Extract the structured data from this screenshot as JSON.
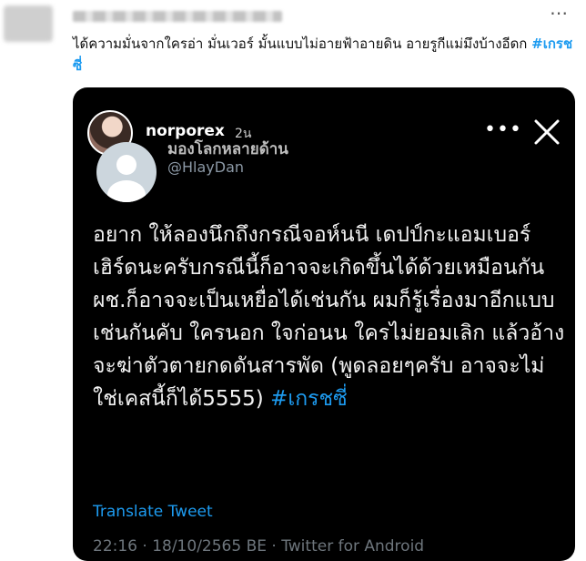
{
  "tweet": {
    "text": "ได้ความมั่นจากใครอ่า มั่นเวอร์ มั้นแบบไม่อายฟ้าอายดิน อายรูกีแม่มึงบ้างอีดก ",
    "hashtag": "#เกรชซี่",
    "more_icon": "more-horizontal-icon"
  },
  "story": {
    "username": "norporex",
    "time": "2น",
    "more_icon": "more-horizontal-icon",
    "close_icon": "close-icon",
    "embedded_tweet": {
      "display_name": "มองโลกหลายด้าน",
      "handle": "@HlayDan",
      "avatar_icon": "default-profile-icon",
      "body": "อยาก ให้ลองนึกถึงกรณีจอห์นนี เดปป์กะแอมเบอร์ เฮิร์ดนะครับกรณีนี้ก็อาจจะเกิดขึ้นได้ด้วยเหมือนกัน ผช.ก็อาจจะเป็นเหยื่อได้เช่นกัน ผมก็รู้เรื่องมาอีกแบบเช่นกันคับ ใครนอก ใจก่อนน ใครไม่ยอมเลิก แล้วอ้างจะฆ่าตัวตายกดดันสารพัด (พูดลอยๆครับ อาจจะไม่ ใช่เคสนี้ก็ได้5555) ",
      "hashtag": "#เกรชซี่",
      "translate_label": "Translate Tweet",
      "meta": "22:16 · 18/10/2565 BE · Twitter for Android"
    }
  },
  "colors": {
    "link": "#1d9bf0",
    "story_bg": "#000000",
    "handle": "#8b98a5"
  }
}
